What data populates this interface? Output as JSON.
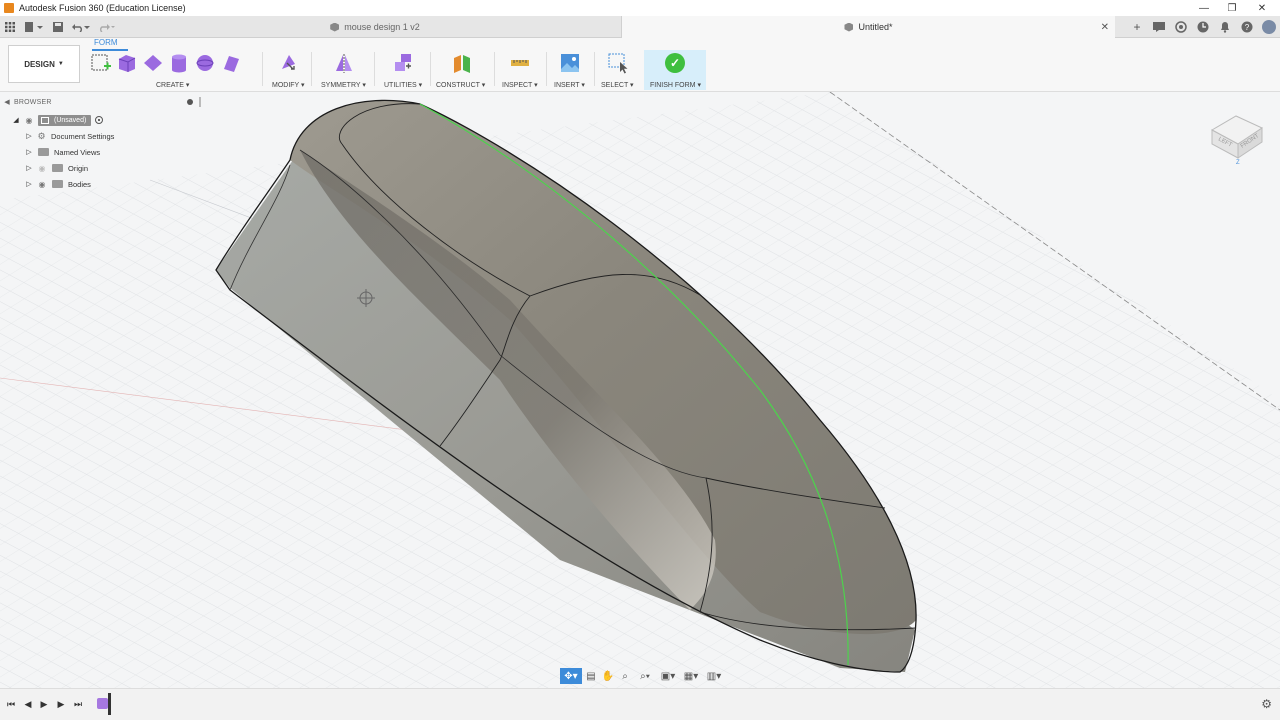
{
  "window": {
    "title": "Autodesk Fusion 360 (Education License)",
    "controls": {
      "minimize": "—",
      "restore": "❐",
      "close": "✕"
    }
  },
  "tabs": [
    {
      "label": "mouse design 1 v2",
      "active": false
    },
    {
      "label": "Untitled*",
      "active": true
    }
  ],
  "toolbar": {
    "workspace": "DESIGN",
    "active_tab": "FORM",
    "groups": [
      {
        "label": "CREATE",
        "icons": [
          "box-form-icon",
          "cube-form-icon",
          "plane-form-icon",
          "cylinder-form-icon",
          "sphere-form-icon",
          "quadball-form-icon"
        ]
      },
      {
        "label": "MODIFY",
        "icons": [
          "edit-form-icon"
        ]
      },
      {
        "label": "SYMMETRY",
        "icons": [
          "mirror-symmetry-icon"
        ]
      },
      {
        "label": "UTILITIES",
        "icons": [
          "utilities-icon"
        ]
      },
      {
        "label": "CONSTRUCT",
        "icons": [
          "construct-plane-icon"
        ]
      },
      {
        "label": "INSPECT",
        "icons": [
          "measure-icon"
        ]
      },
      {
        "label": "INSERT",
        "icons": [
          "insert-image-icon"
        ]
      },
      {
        "label": "SELECT",
        "icons": [
          "select-window-icon"
        ]
      },
      {
        "label": "FINISH FORM",
        "icons": [
          "finish-check-icon"
        ]
      }
    ],
    "accent_color": "#3d8bd9",
    "form_tool_color": "#9b6ae0",
    "finish_color": "#3fbf3f"
  },
  "browser": {
    "title": "BROWSER",
    "root": "(Unsaved)",
    "items": [
      {
        "label": "Document Settings",
        "icon": "gear-icon"
      },
      {
        "label": "Named Views",
        "icon": "folder-icon"
      },
      {
        "label": "Origin",
        "icon": "folder-icon"
      },
      {
        "label": "Bodies",
        "icon": "folder-icon"
      }
    ]
  },
  "viewcube": {
    "faces": [
      "LEFT",
      "FRONT"
    ],
    "axis": "Z"
  },
  "navbar": {
    "tools": [
      "orbit-icon",
      "look-at-icon",
      "pan-icon",
      "zoom-icon",
      "zoom-window-icon",
      "display-settings-icon",
      "grid-icon",
      "viewports-icon"
    ]
  },
  "model": {
    "body_color": "#8f8c83",
    "highlight_edge_color": "#4cd34c"
  }
}
